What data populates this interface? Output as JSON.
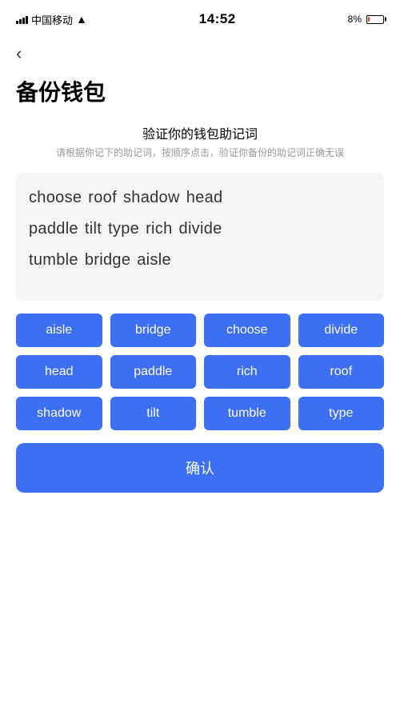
{
  "statusBar": {
    "carrier": "中国移动",
    "time": "14:52",
    "battery": "8%"
  },
  "backButton": {
    "label": "‹"
  },
  "pageTitle": "备份钱包",
  "section": {
    "title": "验证你的钱包助记词",
    "description": "请根据你记下的助记词，按顺序点击，验证你备份的助记词正确无误"
  },
  "wordDisplay": {
    "rows": [
      [
        "choose",
        "roof",
        "shadow",
        "head"
      ],
      [
        "paddle",
        "tilt",
        "type",
        "rich",
        "divide"
      ],
      [
        "tumble",
        "bridge",
        "aisle"
      ]
    ]
  },
  "wordButtons": [
    "aisle",
    "bridge",
    "choose",
    "divide",
    "head",
    "paddle",
    "rich",
    "roof",
    "shadow",
    "tilt",
    "tumble",
    "type"
  ],
  "confirmButton": {
    "label": "确认"
  }
}
